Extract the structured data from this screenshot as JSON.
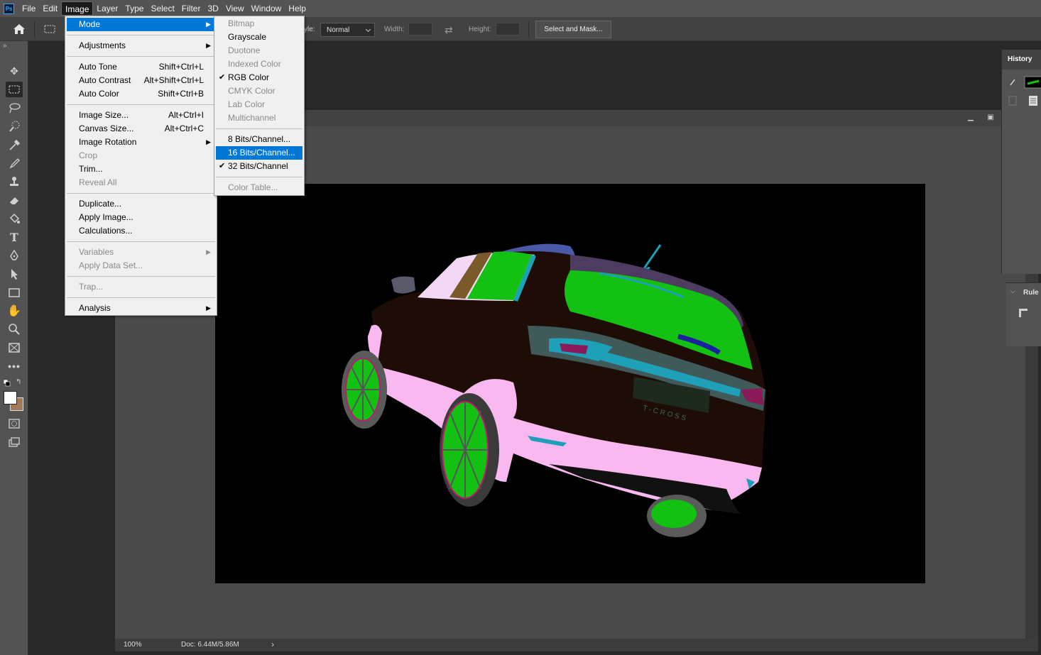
{
  "menubar": {
    "logo": "Ps",
    "items": [
      "File",
      "Edit",
      "Image",
      "Layer",
      "Type",
      "Select",
      "Filter",
      "3D",
      "View",
      "Window",
      "Help"
    ],
    "active_item": "Image"
  },
  "options_bar": {
    "style_label": "yle:",
    "style_value": "Normal",
    "width_label": "Width:",
    "height_label": "Height:",
    "select_and_mask_label": "Select and Mask..."
  },
  "image_menu": [
    {
      "label": "Mode",
      "submenu": true,
      "highlighted": true
    },
    {
      "separator": true
    },
    {
      "label": "Adjustments",
      "submenu": true
    },
    {
      "separator": true
    },
    {
      "label": "Auto Tone",
      "shortcut": "Shift+Ctrl+L"
    },
    {
      "label": "Auto Contrast",
      "shortcut": "Alt+Shift+Ctrl+L"
    },
    {
      "label": "Auto Color",
      "shortcut": "Shift+Ctrl+B"
    },
    {
      "separator": true
    },
    {
      "label": "Image Size...",
      "shortcut": "Alt+Ctrl+I"
    },
    {
      "label": "Canvas Size...",
      "shortcut": "Alt+Ctrl+C"
    },
    {
      "label": "Image Rotation",
      "submenu": true
    },
    {
      "label": "Crop",
      "disabled": true
    },
    {
      "label": "Trim..."
    },
    {
      "label": "Reveal All",
      "disabled": true
    },
    {
      "separator": true
    },
    {
      "label": "Duplicate..."
    },
    {
      "label": "Apply Image..."
    },
    {
      "label": "Calculations..."
    },
    {
      "separator": true
    },
    {
      "label": "Variables",
      "submenu": true,
      "disabled": true
    },
    {
      "label": "Apply Data Set...",
      "disabled": true
    },
    {
      "separator": true
    },
    {
      "label": "Trap...",
      "disabled": true
    },
    {
      "separator": true
    },
    {
      "label": "Analysis",
      "submenu": true
    }
  ],
  "mode_submenu": [
    {
      "label": "Bitmap",
      "disabled": true
    },
    {
      "label": "Grayscale"
    },
    {
      "label": "Duotone",
      "disabled": true
    },
    {
      "label": "Indexed Color",
      "disabled": true
    },
    {
      "label": "RGB Color",
      "checked": true
    },
    {
      "label": "CMYK Color",
      "disabled": true
    },
    {
      "label": "Lab Color",
      "disabled": true
    },
    {
      "label": "Multichannel",
      "disabled": true
    },
    {
      "separator": true
    },
    {
      "label": "8 Bits/Channel..."
    },
    {
      "label": "16 Bits/Channel...",
      "highlighted": true
    },
    {
      "label": "32 Bits/Channel",
      "checked": true
    },
    {
      "separator": true
    },
    {
      "label": "Color Table...",
      "disabled": true
    }
  ],
  "panels": {
    "history_label": "History",
    "ruler_label": "Rule"
  },
  "status_bar": {
    "zoom": "100%",
    "doc_size": "Doc: 6.44M/5.86M"
  },
  "colors": {
    "menu_highlight": "#0078d7",
    "car_body": "#1e0c06",
    "car_pink": "#f9b8f0",
    "car_green": "#13c113",
    "car_cyan": "#1ea0b8"
  },
  "canvas": {
    "car_badge": "T-CROSS"
  }
}
